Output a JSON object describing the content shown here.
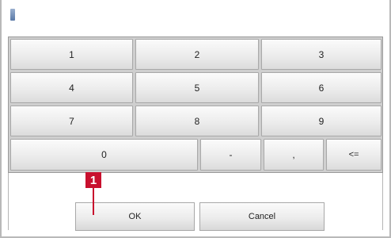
{
  "keypad": {
    "rows": [
      [
        "1",
        "2",
        "3"
      ],
      [
        "4",
        "5",
        "6"
      ],
      [
        "7",
        "8",
        "9"
      ]
    ],
    "zero": "0",
    "minus": "-",
    "comma": ",",
    "backspace": "<="
  },
  "dialog": {
    "ok_label": "OK",
    "cancel_label": "Cancel"
  },
  "callout": {
    "number": "1",
    "color": "#c8102e"
  },
  "icons": {
    "cursor": "text-cursor-icon"
  }
}
